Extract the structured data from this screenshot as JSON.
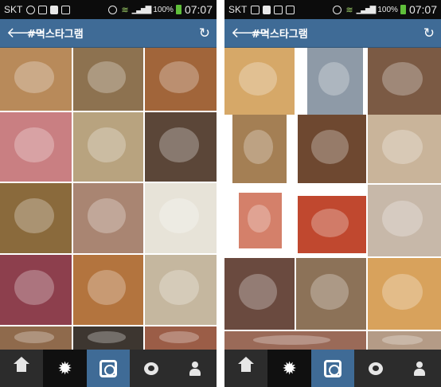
{
  "screens": [
    {
      "status_bar": {
        "carrier": "SKT",
        "battery": "100%",
        "time": "07:07"
      },
      "header": {
        "title": "#먹스타그램"
      },
      "photos": [
        {
          "name": "dessert-bowl-photo",
          "color": "#b88a5a"
        },
        {
          "name": "food-collage-photo",
          "color": "#8d7250"
        },
        {
          "name": "dining-table-photo",
          "color": "#a1653a"
        },
        {
          "name": "pink-drink-photo",
          "color": "#c97f82"
        },
        {
          "name": "small-plates-photo",
          "color": "#b8a37f"
        },
        {
          "name": "grilled-ribs-photo",
          "color": "#5b4638"
        },
        {
          "name": "beer-snack-photo",
          "color": "#8a6a3c"
        },
        {
          "name": "restaurant-sign-photo",
          "color": "#a98572"
        },
        {
          "name": "hand-berries-photo",
          "color": "#e7e3d8"
        },
        {
          "name": "berry-dessert-photo",
          "color": "#8d3f4d"
        },
        {
          "name": "plated-meal-photo",
          "color": "#b3743e"
        },
        {
          "name": "pasta-dish-photo",
          "color": "#c5b79f"
        },
        {
          "name": "skewers-photo",
          "color": "#8f6a4c"
        },
        {
          "name": "table-edge-photo",
          "color": "#3d3630"
        },
        {
          "name": "salad-plate-photo",
          "color": "#9b5d47"
        }
      ]
    },
    {
      "status_bar": {
        "carrier": "SKT",
        "battery": "100%",
        "time": "07:07"
      },
      "header": {
        "title": "#먹스타그램"
      },
      "photos": [
        {
          "name": "ramen-egg-photo",
          "color": "#d6a868"
        },
        {
          "name": "city-view-photo",
          "color": "#8e9aa7"
        },
        {
          "name": "banchan-table-photo",
          "color": "#7b5a44"
        },
        {
          "name": "noodle-bowl-photo",
          "color": "#a47f54"
        },
        {
          "name": "hot-pot-photo",
          "color": "#6e4830"
        },
        {
          "name": "dumplings-photo",
          "color": "#c9b49a"
        },
        {
          "name": "watermelon-photo",
          "color": "#d4806a"
        },
        {
          "name": "spicy-stew-photo",
          "color": "#c0482f"
        },
        {
          "name": "soup-spread-photo",
          "color": "#c7b8a9"
        },
        {
          "name": "iced-coffee-photo",
          "color": "#6a4a3f"
        },
        {
          "name": "bar-snacks-photo",
          "color": "#8c7258"
        },
        {
          "name": "noodle-soup-photo",
          "color": "#d8a25c"
        },
        {
          "name": "appetizers-photo",
          "color": "#9a6a58"
        },
        {
          "name": "cafe-table-photo",
          "color": "#b49b86"
        }
      ]
    }
  ]
}
